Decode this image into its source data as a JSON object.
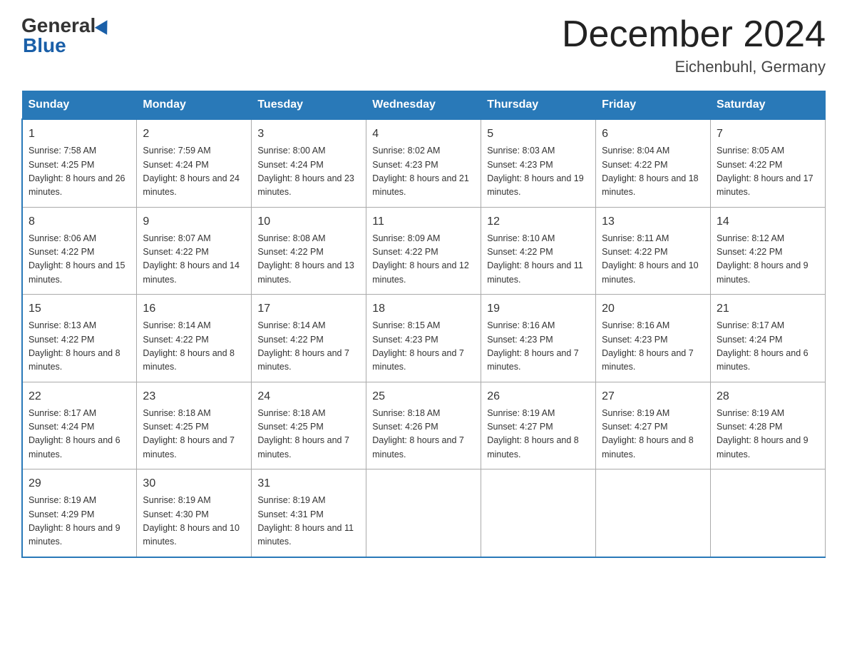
{
  "header": {
    "logo_general": "General",
    "logo_blue": "Blue",
    "month_title": "December 2024",
    "location": "Eichenbuhl, Germany"
  },
  "days_of_week": [
    "Sunday",
    "Monday",
    "Tuesday",
    "Wednesday",
    "Thursday",
    "Friday",
    "Saturday"
  ],
  "weeks": [
    [
      {
        "day": "1",
        "sunrise": "7:58 AM",
        "sunset": "4:25 PM",
        "daylight": "8 hours and 26 minutes."
      },
      {
        "day": "2",
        "sunrise": "7:59 AM",
        "sunset": "4:24 PM",
        "daylight": "8 hours and 24 minutes."
      },
      {
        "day": "3",
        "sunrise": "8:00 AM",
        "sunset": "4:24 PM",
        "daylight": "8 hours and 23 minutes."
      },
      {
        "day": "4",
        "sunrise": "8:02 AM",
        "sunset": "4:23 PM",
        "daylight": "8 hours and 21 minutes."
      },
      {
        "day": "5",
        "sunrise": "8:03 AM",
        "sunset": "4:23 PM",
        "daylight": "8 hours and 19 minutes."
      },
      {
        "day": "6",
        "sunrise": "8:04 AM",
        "sunset": "4:22 PM",
        "daylight": "8 hours and 18 minutes."
      },
      {
        "day": "7",
        "sunrise": "8:05 AM",
        "sunset": "4:22 PM",
        "daylight": "8 hours and 17 minutes."
      }
    ],
    [
      {
        "day": "8",
        "sunrise": "8:06 AM",
        "sunset": "4:22 PM",
        "daylight": "8 hours and 15 minutes."
      },
      {
        "day": "9",
        "sunrise": "8:07 AM",
        "sunset": "4:22 PM",
        "daylight": "8 hours and 14 minutes."
      },
      {
        "day": "10",
        "sunrise": "8:08 AM",
        "sunset": "4:22 PM",
        "daylight": "8 hours and 13 minutes."
      },
      {
        "day": "11",
        "sunrise": "8:09 AM",
        "sunset": "4:22 PM",
        "daylight": "8 hours and 12 minutes."
      },
      {
        "day": "12",
        "sunrise": "8:10 AM",
        "sunset": "4:22 PM",
        "daylight": "8 hours and 11 minutes."
      },
      {
        "day": "13",
        "sunrise": "8:11 AM",
        "sunset": "4:22 PM",
        "daylight": "8 hours and 10 minutes."
      },
      {
        "day": "14",
        "sunrise": "8:12 AM",
        "sunset": "4:22 PM",
        "daylight": "8 hours and 9 minutes."
      }
    ],
    [
      {
        "day": "15",
        "sunrise": "8:13 AM",
        "sunset": "4:22 PM",
        "daylight": "8 hours and 8 minutes."
      },
      {
        "day": "16",
        "sunrise": "8:14 AM",
        "sunset": "4:22 PM",
        "daylight": "8 hours and 8 minutes."
      },
      {
        "day": "17",
        "sunrise": "8:14 AM",
        "sunset": "4:22 PM",
        "daylight": "8 hours and 7 minutes."
      },
      {
        "day": "18",
        "sunrise": "8:15 AM",
        "sunset": "4:23 PM",
        "daylight": "8 hours and 7 minutes."
      },
      {
        "day": "19",
        "sunrise": "8:16 AM",
        "sunset": "4:23 PM",
        "daylight": "8 hours and 7 minutes."
      },
      {
        "day": "20",
        "sunrise": "8:16 AM",
        "sunset": "4:23 PM",
        "daylight": "8 hours and 7 minutes."
      },
      {
        "day": "21",
        "sunrise": "8:17 AM",
        "sunset": "4:24 PM",
        "daylight": "8 hours and 6 minutes."
      }
    ],
    [
      {
        "day": "22",
        "sunrise": "8:17 AM",
        "sunset": "4:24 PM",
        "daylight": "8 hours and 6 minutes."
      },
      {
        "day": "23",
        "sunrise": "8:18 AM",
        "sunset": "4:25 PM",
        "daylight": "8 hours and 7 minutes."
      },
      {
        "day": "24",
        "sunrise": "8:18 AM",
        "sunset": "4:25 PM",
        "daylight": "8 hours and 7 minutes."
      },
      {
        "day": "25",
        "sunrise": "8:18 AM",
        "sunset": "4:26 PM",
        "daylight": "8 hours and 7 minutes."
      },
      {
        "day": "26",
        "sunrise": "8:19 AM",
        "sunset": "4:27 PM",
        "daylight": "8 hours and 8 minutes."
      },
      {
        "day": "27",
        "sunrise": "8:19 AM",
        "sunset": "4:27 PM",
        "daylight": "8 hours and 8 minutes."
      },
      {
        "day": "28",
        "sunrise": "8:19 AM",
        "sunset": "4:28 PM",
        "daylight": "8 hours and 9 minutes."
      }
    ],
    [
      {
        "day": "29",
        "sunrise": "8:19 AM",
        "sunset": "4:29 PM",
        "daylight": "8 hours and 9 minutes."
      },
      {
        "day": "30",
        "sunrise": "8:19 AM",
        "sunset": "4:30 PM",
        "daylight": "8 hours and 10 minutes."
      },
      {
        "day": "31",
        "sunrise": "8:19 AM",
        "sunset": "4:31 PM",
        "daylight": "8 hours and 11 minutes."
      },
      null,
      null,
      null,
      null
    ]
  ]
}
